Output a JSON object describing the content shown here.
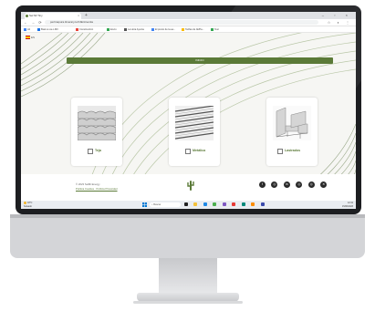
{
  "browser": {
    "tab_title": "Sel Mi Tiny",
    "tab_close": "×",
    "new_tab": "+",
    "window_controls": "– ▫ ×",
    "nav_icons": "← → ⟳",
    "url": "pertinapura.itinerary.to/CIEntinentia",
    "addr_icons": "☆ ◐ ⋮",
    "bookmarks": [
      {
        "label": "Alt",
        "color": "#4285f4"
      },
      {
        "label": "Bsal so ca o-MII",
        "color": "#1a73e8"
      },
      {
        "label": "Construcción",
        "color": "#e8453c"
      },
      {
        "label": "Envío",
        "color": "#34a853"
      },
      {
        "label": "La Hora Ayunta",
        "color": "#555555"
      },
      {
        "label": "El precio de la ea...",
        "color": "#4285f4"
      },
      {
        "label": "Tarifas de Ali/Pa...",
        "color": "#fbbc05"
      },
      {
        "label": "Test",
        "color": "#34a853"
      }
    ]
  },
  "page": {
    "lang": "ES",
    "banner": "INICIO",
    "cards": [
      {
        "label": "Teja",
        "icon": "tile-roof-icon"
      },
      {
        "label": "Metálica",
        "icon": "metal-roof-icon"
      },
      {
        "label": "Lastrados",
        "icon": "ballast-mount-icon"
      }
    ]
  },
  "footer": {
    "copyright": "© 2023 SelMi Energy",
    "links": "Política Cookies · Política Privacidad",
    "social": [
      "f",
      "◎",
      "in",
      "◎",
      "◎",
      "✕"
    ]
  },
  "taskbar": {
    "weather": "18°C",
    "weather_sub": "Soleado",
    "search": "Buscar",
    "tray_time": "12:41",
    "tray_date": "15/06/2023"
  },
  "colors": {
    "brand_green": "#5b7a38"
  }
}
